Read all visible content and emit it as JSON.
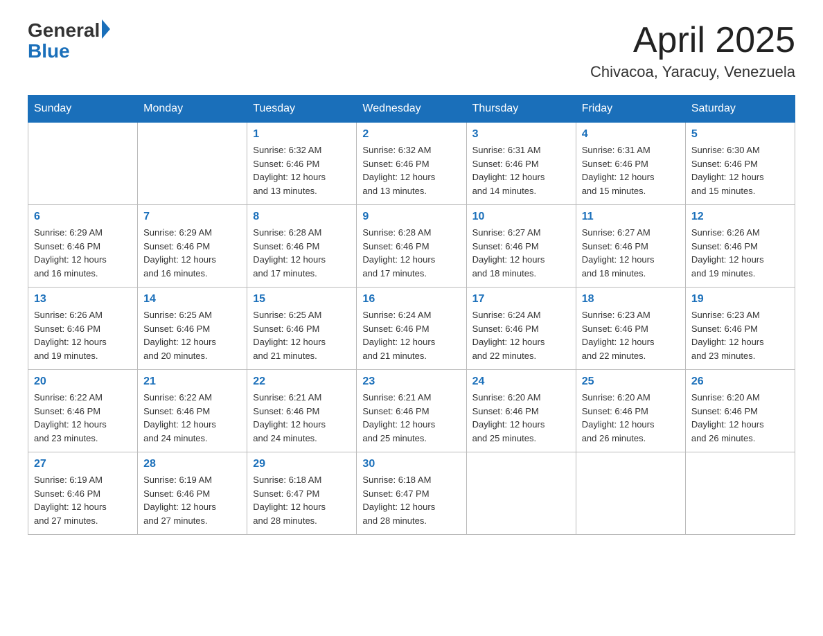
{
  "header": {
    "logo_general": "General",
    "logo_blue": "Blue",
    "month_title": "April 2025",
    "location": "Chivacoa, Yaracuy, Venezuela"
  },
  "weekdays": [
    "Sunday",
    "Monday",
    "Tuesday",
    "Wednesday",
    "Thursday",
    "Friday",
    "Saturday"
  ],
  "weeks": [
    [
      {
        "day": "",
        "info": ""
      },
      {
        "day": "",
        "info": ""
      },
      {
        "day": "1",
        "info": "Sunrise: 6:32 AM\nSunset: 6:46 PM\nDaylight: 12 hours\nand 13 minutes."
      },
      {
        "day": "2",
        "info": "Sunrise: 6:32 AM\nSunset: 6:46 PM\nDaylight: 12 hours\nand 13 minutes."
      },
      {
        "day": "3",
        "info": "Sunrise: 6:31 AM\nSunset: 6:46 PM\nDaylight: 12 hours\nand 14 minutes."
      },
      {
        "day": "4",
        "info": "Sunrise: 6:31 AM\nSunset: 6:46 PM\nDaylight: 12 hours\nand 15 minutes."
      },
      {
        "day": "5",
        "info": "Sunrise: 6:30 AM\nSunset: 6:46 PM\nDaylight: 12 hours\nand 15 minutes."
      }
    ],
    [
      {
        "day": "6",
        "info": "Sunrise: 6:29 AM\nSunset: 6:46 PM\nDaylight: 12 hours\nand 16 minutes."
      },
      {
        "day": "7",
        "info": "Sunrise: 6:29 AM\nSunset: 6:46 PM\nDaylight: 12 hours\nand 16 minutes."
      },
      {
        "day": "8",
        "info": "Sunrise: 6:28 AM\nSunset: 6:46 PM\nDaylight: 12 hours\nand 17 minutes."
      },
      {
        "day": "9",
        "info": "Sunrise: 6:28 AM\nSunset: 6:46 PM\nDaylight: 12 hours\nand 17 minutes."
      },
      {
        "day": "10",
        "info": "Sunrise: 6:27 AM\nSunset: 6:46 PM\nDaylight: 12 hours\nand 18 minutes."
      },
      {
        "day": "11",
        "info": "Sunrise: 6:27 AM\nSunset: 6:46 PM\nDaylight: 12 hours\nand 18 minutes."
      },
      {
        "day": "12",
        "info": "Sunrise: 6:26 AM\nSunset: 6:46 PM\nDaylight: 12 hours\nand 19 minutes."
      }
    ],
    [
      {
        "day": "13",
        "info": "Sunrise: 6:26 AM\nSunset: 6:46 PM\nDaylight: 12 hours\nand 19 minutes."
      },
      {
        "day": "14",
        "info": "Sunrise: 6:25 AM\nSunset: 6:46 PM\nDaylight: 12 hours\nand 20 minutes."
      },
      {
        "day": "15",
        "info": "Sunrise: 6:25 AM\nSunset: 6:46 PM\nDaylight: 12 hours\nand 21 minutes."
      },
      {
        "day": "16",
        "info": "Sunrise: 6:24 AM\nSunset: 6:46 PM\nDaylight: 12 hours\nand 21 minutes."
      },
      {
        "day": "17",
        "info": "Sunrise: 6:24 AM\nSunset: 6:46 PM\nDaylight: 12 hours\nand 22 minutes."
      },
      {
        "day": "18",
        "info": "Sunrise: 6:23 AM\nSunset: 6:46 PM\nDaylight: 12 hours\nand 22 minutes."
      },
      {
        "day": "19",
        "info": "Sunrise: 6:23 AM\nSunset: 6:46 PM\nDaylight: 12 hours\nand 23 minutes."
      }
    ],
    [
      {
        "day": "20",
        "info": "Sunrise: 6:22 AM\nSunset: 6:46 PM\nDaylight: 12 hours\nand 23 minutes."
      },
      {
        "day": "21",
        "info": "Sunrise: 6:22 AM\nSunset: 6:46 PM\nDaylight: 12 hours\nand 24 minutes."
      },
      {
        "day": "22",
        "info": "Sunrise: 6:21 AM\nSunset: 6:46 PM\nDaylight: 12 hours\nand 24 minutes."
      },
      {
        "day": "23",
        "info": "Sunrise: 6:21 AM\nSunset: 6:46 PM\nDaylight: 12 hours\nand 25 minutes."
      },
      {
        "day": "24",
        "info": "Sunrise: 6:20 AM\nSunset: 6:46 PM\nDaylight: 12 hours\nand 25 minutes."
      },
      {
        "day": "25",
        "info": "Sunrise: 6:20 AM\nSunset: 6:46 PM\nDaylight: 12 hours\nand 26 minutes."
      },
      {
        "day": "26",
        "info": "Sunrise: 6:20 AM\nSunset: 6:46 PM\nDaylight: 12 hours\nand 26 minutes."
      }
    ],
    [
      {
        "day": "27",
        "info": "Sunrise: 6:19 AM\nSunset: 6:46 PM\nDaylight: 12 hours\nand 27 minutes."
      },
      {
        "day": "28",
        "info": "Sunrise: 6:19 AM\nSunset: 6:46 PM\nDaylight: 12 hours\nand 27 minutes."
      },
      {
        "day": "29",
        "info": "Sunrise: 6:18 AM\nSunset: 6:47 PM\nDaylight: 12 hours\nand 28 minutes."
      },
      {
        "day": "30",
        "info": "Sunrise: 6:18 AM\nSunset: 6:47 PM\nDaylight: 12 hours\nand 28 minutes."
      },
      {
        "day": "",
        "info": ""
      },
      {
        "day": "",
        "info": ""
      },
      {
        "day": "",
        "info": ""
      }
    ]
  ]
}
